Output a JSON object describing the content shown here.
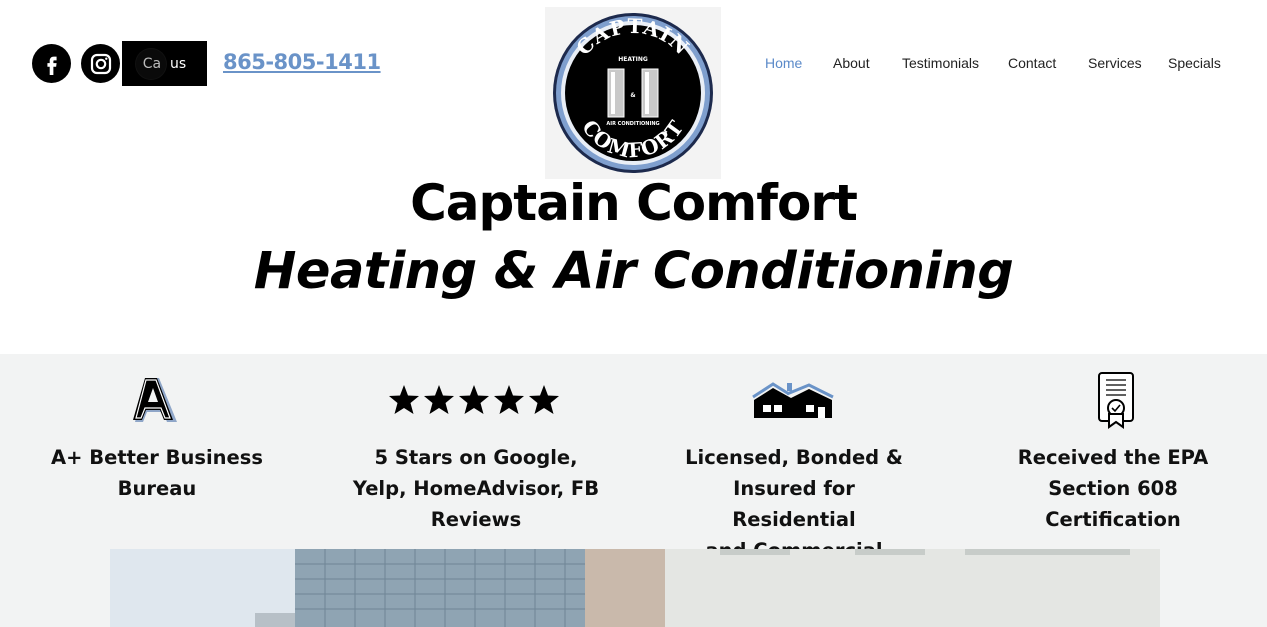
{
  "header": {
    "social": [
      {
        "name": "facebook",
        "icon": "facebook-icon"
      },
      {
        "name": "instagram",
        "icon": "instagram-icon"
      }
    ],
    "call_button": {
      "label": "Ca",
      "label_end": "us"
    },
    "phone": "865-805-1411",
    "logo": {
      "top_text": "CAPTAIN",
      "bottom_text": "COMFORT",
      "inner_top": "HEATING",
      "inner_mid": "&",
      "inner_bottom": "AIR CONDITIONING"
    },
    "nav": [
      {
        "label": "Home",
        "active": true
      },
      {
        "label": "About",
        "active": false
      },
      {
        "label": "Testimonials",
        "active": false
      },
      {
        "label": "Contact",
        "active": false
      },
      {
        "label": "Services",
        "active": false
      },
      {
        "label": "Specials",
        "active": false
      }
    ],
    "title": "Captain Comfort",
    "subtitle": "Heating & Air Conditioning"
  },
  "features": [
    {
      "icon": "a-plus-rating-icon",
      "lines": [
        "A+ Better Business",
        "Bureau"
      ]
    },
    {
      "icon": "five-stars-icon",
      "lines": [
        "5 Stars on Google,",
        "Yelp, HomeAdvisor, FB",
        "Reviews"
      ]
    },
    {
      "icon": "houses-icon",
      "lines": [
        "Licensed, Bonded &",
        "Insured for Residential",
        "and Commercial"
      ]
    },
    {
      "icon": "certificate-icon",
      "lines": [
        "Received the EPA",
        "Section 608",
        "Certification"
      ]
    }
  ],
  "colors": {
    "accent": "#5b8ac9",
    "phone": "#6a93c8",
    "features_bg": "#f2f3f3"
  }
}
